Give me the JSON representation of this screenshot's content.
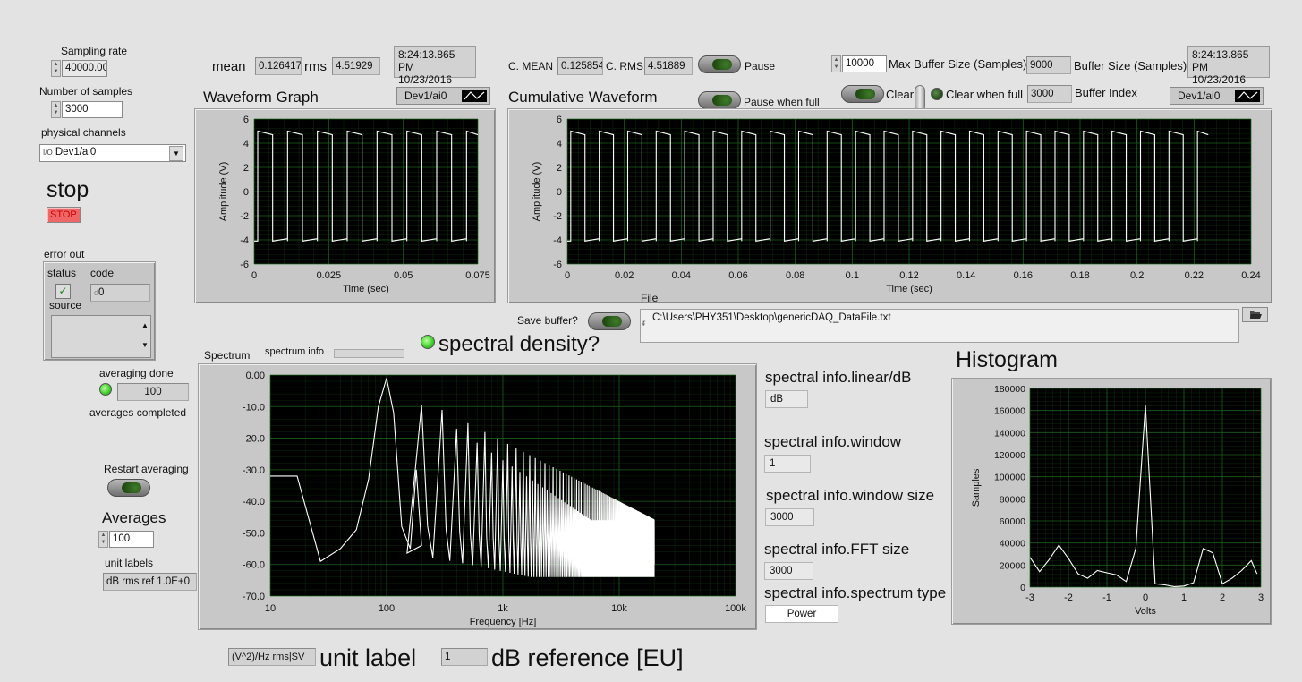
{
  "colors": {
    "panel_bg": "#e3e3e3",
    "plot_bg": "#000000",
    "grid": "#1e6a1e",
    "trace": "#ffffff",
    "led_on": "#3ccd2a",
    "stop_red": "#e66666"
  },
  "icons": {
    "folder": "folder-icon",
    "pause": "toggle-button",
    "led": "led-indicator"
  },
  "sampling": {
    "rate_label": "Sampling rate",
    "rate_value": "40000.00",
    "nsamples_label": "Number of samples",
    "nsamples_value": "3000",
    "channel_label": "physical channels",
    "channel_value": "Dev1/ai0",
    "channel_glyph": "I/O"
  },
  "stop": {
    "label": "stop",
    "button": "STOP"
  },
  "error": {
    "title": "error out",
    "status_label": "status",
    "code_label": "code",
    "code_value": "0",
    "code_glyph": "d",
    "source_label": "source"
  },
  "avg": {
    "done_label": "averaging done",
    "count": "100",
    "completed_label": "averages completed",
    "restart_label": "Restart averaging",
    "averages_label": "Averages",
    "averages_value": "100",
    "unit_labels_label": "unit labels",
    "unit_labels_value": "dB rms ref 1.0E+0"
  },
  "stats": {
    "mean_label": "mean",
    "mean_value": "0.126417",
    "rms_label": "rms",
    "rms_value": "4.51929",
    "time": "8:24:13.865 PM",
    "date": "10/23/2016",
    "cmean_label": "C. MEAN",
    "cmean_value": "0.125854",
    "crms_label": "C. RMS",
    "crms_value": "4.51889"
  },
  "controls": {
    "pause": "Pause",
    "pause_full": "Pause when full",
    "max_buffer_value": "10000",
    "max_buffer_label": "Max Buffer Size (Samples)",
    "buffer_size_value": "9000",
    "buffer_size_label": "Buffer Size (Samples)",
    "time2": "8:24:13.865 PM",
    "date2": "10/23/2016",
    "clear": "Clear",
    "clear_full": "Clear when full",
    "buffer_index_value": "3000",
    "buffer_index_label": "Buffer Index"
  },
  "waveform": {
    "title": "Waveform Graph",
    "legend": "Dev1/ai0",
    "xlabel": "Time (sec)",
    "ylabel": "Amplitude (V)",
    "yticks": [
      "6",
      "4",
      "2",
      "0",
      "-2",
      "-4",
      "-6"
    ],
    "xticks": [
      "0",
      "0.025",
      "0.05",
      "0.075"
    ]
  },
  "cumulative": {
    "title": "Cumulative Waveform",
    "legend": "Dev1/ai0",
    "xlabel": "Time (sec)",
    "ylabel": "Amplitude (V)",
    "yticks": [
      "6",
      "4",
      "2",
      "0",
      "-2",
      "-4",
      "-6"
    ],
    "xticks": [
      "0",
      "0.02",
      "0.04",
      "0.06",
      "0.08",
      "0.1",
      "0.12",
      "0.14",
      "0.16",
      "0.18",
      "0.2",
      "0.22",
      "0.24"
    ]
  },
  "file": {
    "label": "File",
    "save_label": "Save buffer?",
    "path": "C:\\Users\\PHY351\\Desktop\\genericDAQ_DataFile.txt",
    "path_glyph": "ᵲ"
  },
  "spectrum": {
    "title": "Spectrum",
    "info_label": "spectrum info",
    "density_label": "spectral density?",
    "xlabel": "Frequency [Hz]",
    "yticks": [
      "0.00",
      "-10.0",
      "-20.0",
      "-30.0",
      "-40.0",
      "-50.0",
      "-60.0",
      "-70.0"
    ],
    "xticks": [
      "10",
      "100",
      "1k",
      "10k",
      "100k"
    ]
  },
  "spectral_info": {
    "lin_label": "spectral info.linear/dB",
    "lin_value": "dB",
    "win_label": "spectral info.window",
    "win_value": "1",
    "winsize_label": "spectral info.window size",
    "winsize_value": "3000",
    "fft_label": "spectral info.FFT size",
    "fft_value": "3000",
    "type_label": "spectral info.spectrum type",
    "type_value": "Power"
  },
  "histogram": {
    "title": "Histogram",
    "xlabel": "Volts",
    "ylabel": "Samples",
    "yticks": [
      "180000",
      "160000",
      "140000",
      "120000",
      "100000",
      "80000",
      "60000",
      "40000",
      "20000",
      "0"
    ],
    "xticks": [
      "-3",
      "-2",
      "-1",
      "0",
      "1",
      "2",
      "3"
    ]
  },
  "bottom": {
    "unit_value": "(V^2)/Hz rms|SV",
    "unit_label": "unit label",
    "dbref_value": "1",
    "dbref_label": "dB reference [EU]"
  },
  "chart_data": [
    {
      "type": "line",
      "name": "Waveform Graph",
      "xlabel": "Time (sec)",
      "ylabel": "Amplitude (V)",
      "xlim": [
        0,
        0.075
      ],
      "ylim": [
        -6,
        6
      ],
      "signal": "square wave",
      "period": 0.01,
      "high": 5,
      "low": -4.1
    },
    {
      "type": "line",
      "name": "Cumulative Waveform",
      "xlabel": "Time (sec)",
      "ylabel": "Amplitude (V)",
      "xlim": [
        0,
        0.24
      ],
      "ylim": [
        -6,
        6
      ],
      "signal": "square wave",
      "period": 0.01,
      "data_end": 0.225,
      "high": 5,
      "low": -4.1
    },
    {
      "type": "line",
      "name": "Spectrum",
      "xlabel": "Frequency [Hz]",
      "xscale": "log",
      "xlim": [
        10,
        100000
      ],
      "ylim": [
        -70,
        0
      ],
      "fundamental_hz": 100,
      "x": [
        10,
        17,
        27,
        40,
        55,
        70,
        85,
        100,
        115,
        135,
        160,
        180,
        200
      ],
      "y": [
        -32,
        -32,
        -59,
        -55,
        -49,
        -33,
        -10,
        -1,
        -12,
        -48,
        -55,
        -30,
        -54
      ]
    },
    {
      "type": "line",
      "name": "Histogram",
      "xlabel": "Volts",
      "ylabel": "Samples",
      "xlim": [
        -3,
        3
      ],
      "ylim": [
        0,
        180000
      ],
      "x": [
        -3,
        -2.75,
        -2.5,
        -2.25,
        -2,
        -1.75,
        -1.5,
        -1.25,
        -1,
        -0.75,
        -0.5,
        -0.25,
        0,
        0.25,
        0.5,
        0.75,
        1,
        1.25,
        1.5,
        1.75,
        2,
        2.25,
        2.5,
        2.75,
        2.9
      ],
      "y": [
        27000,
        14000,
        25000,
        38000,
        26000,
        12000,
        8000,
        15000,
        13000,
        11000,
        5000,
        35000,
        165000,
        3000,
        2000,
        500,
        1000,
        4000,
        35000,
        31000,
        3000,
        8000,
        15000,
        24000,
        12000
      ]
    }
  ]
}
